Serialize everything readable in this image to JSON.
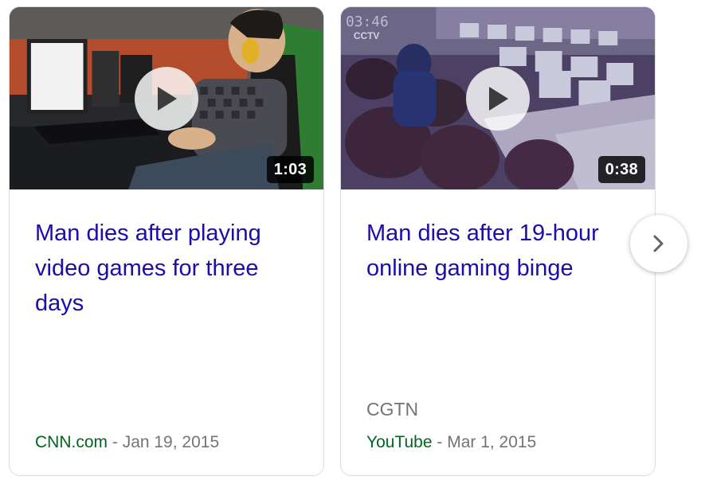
{
  "cards": [
    {
      "title": "Man dies after playing video games for three days",
      "duration": "1:03",
      "channel": "",
      "source": "CNN.com",
      "separator": " - ",
      "date": "Jan 19, 2015"
    },
    {
      "title": "Man dies after 19-hour online gaming binge",
      "duration": "0:38",
      "channel": "CGTN",
      "source": "YouTube",
      "separator": " - ",
      "date": "Mar 1, 2015",
      "watermark": "CCTV"
    }
  ],
  "icons": {
    "play": "play-icon",
    "next": "chevron-right-icon"
  },
  "colors": {
    "title": "#1a0dab",
    "source": "#006621",
    "muted": "#70757a",
    "border": "#dadce0"
  }
}
